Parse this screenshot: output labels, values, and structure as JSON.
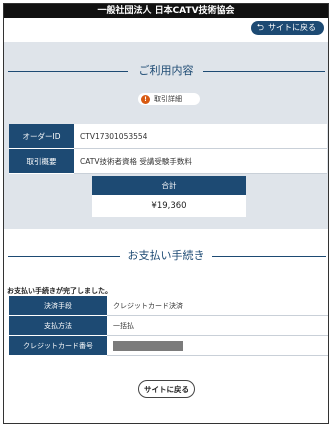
{
  "org_bar": {
    "title": "一般社団法人 日本CATV技術協会"
  },
  "nav": {
    "back_label": "サイトに戻る",
    "back_icon": "return-arrow-icon"
  },
  "usage": {
    "section_title": "ご利用内容",
    "detail_button": {
      "icon_text": "!",
      "label": "取引詳細"
    },
    "rows": [
      {
        "label": "オーダーID",
        "value": "CTV17301053554"
      },
      {
        "label": "取引概要",
        "value": "CATV技術者資格 受講受験手数料"
      }
    ],
    "total": {
      "label": "合計",
      "amount": "¥19,360"
    }
  },
  "payment": {
    "section_title": "お支払い手続き",
    "message": "お支払い手続きが完了しました。",
    "rows": [
      {
        "label": "決済手段",
        "value": "クレジットカード決済"
      },
      {
        "label": "支払方法",
        "value": "一括払"
      },
      {
        "label": "クレジットカード番号",
        "value": ""
      }
    ]
  },
  "footer": {
    "back_label": "サイトに戻る"
  },
  "colors": {
    "primary": "#1d4a73",
    "panel": "#dfe4ea",
    "accent": "#d85a12"
  }
}
